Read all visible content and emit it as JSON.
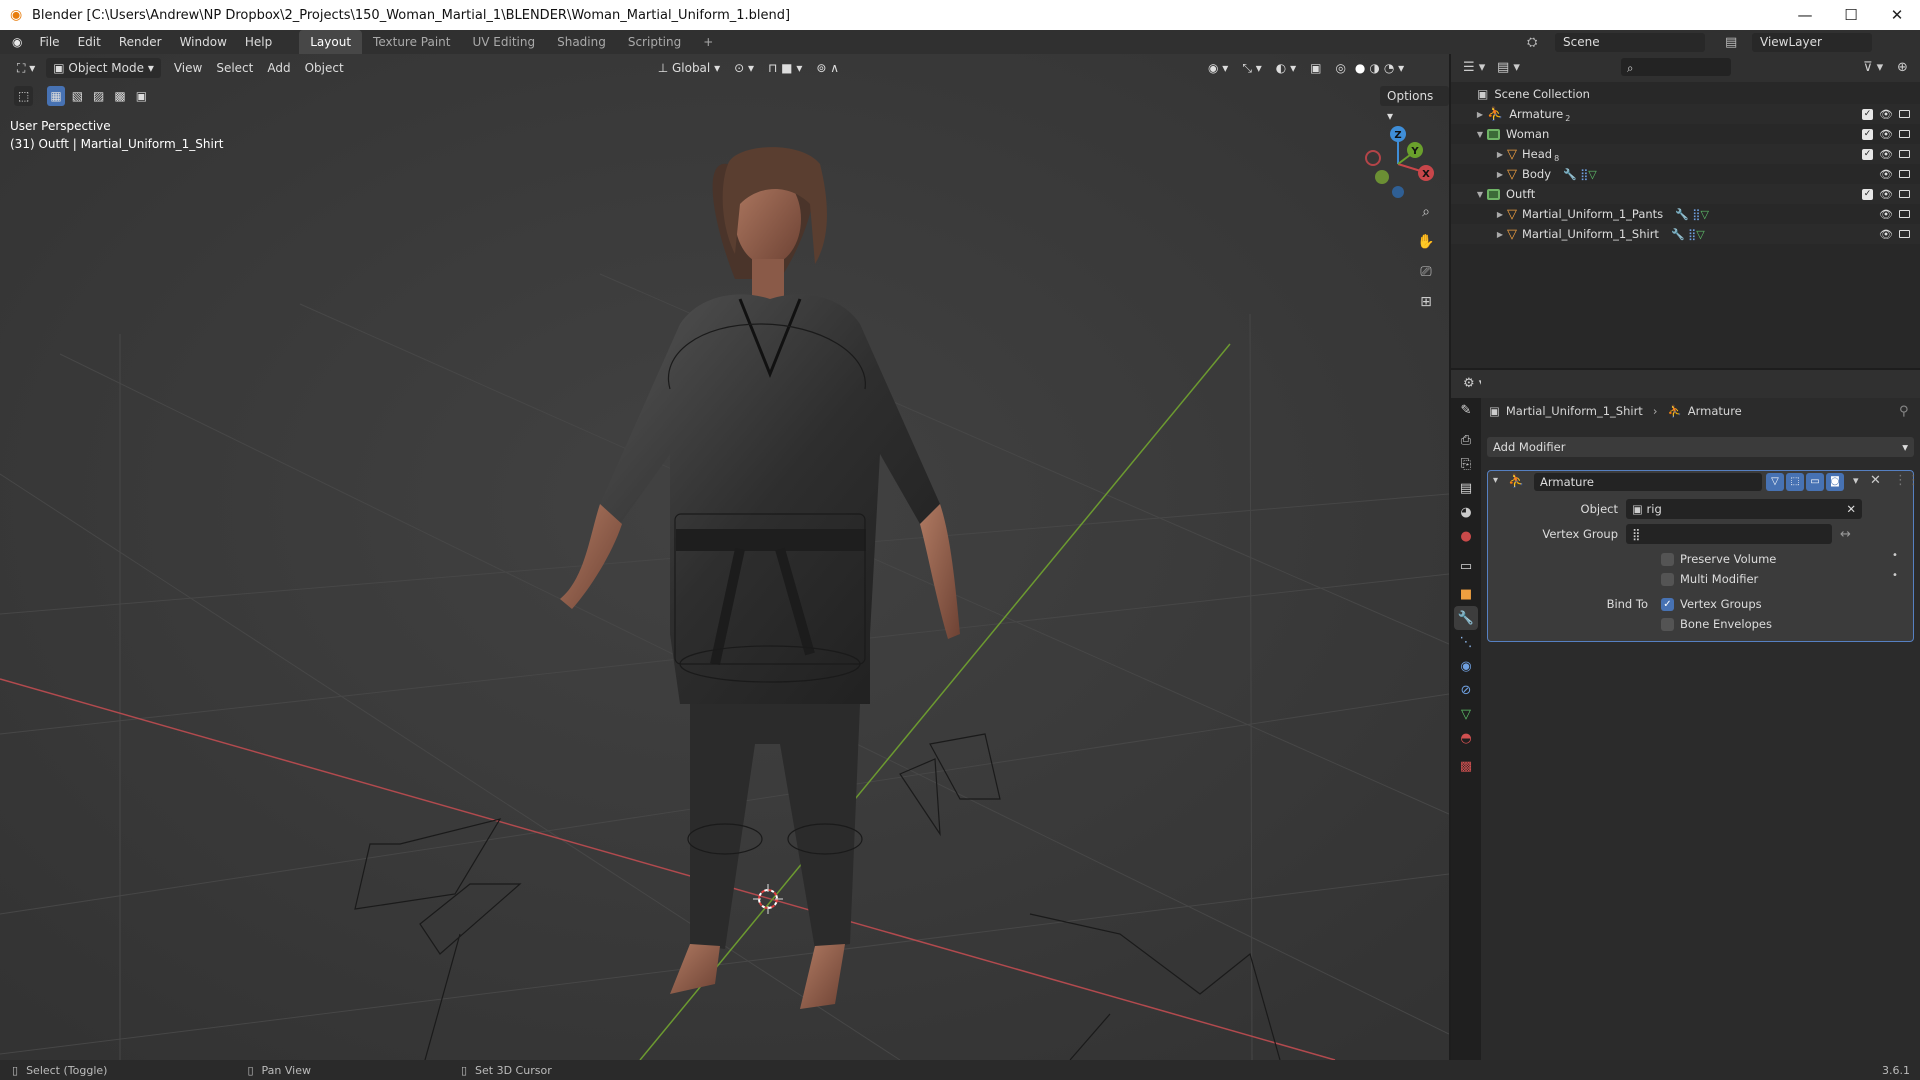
{
  "window": {
    "title": "Blender [C:\\Users\\Andrew\\NP Dropbox\\2_Projects\\150_Woman_Martial_1\\BLENDER\\Woman_Martial_Uniform_1.blend]",
    "minimize": "—",
    "maximize": "☐",
    "close": "✕"
  },
  "menu": [
    "File",
    "Edit",
    "Render",
    "Window",
    "Help"
  ],
  "workspaces": [
    "Layout",
    "Texture Paint",
    "UV Editing",
    "Shading",
    "Scripting",
    "+"
  ],
  "scene": {
    "name": "Scene",
    "view_layer": "ViewLayer"
  },
  "viewport": {
    "mode": "Object Mode",
    "menus": [
      "View",
      "Select",
      "Add",
      "Object"
    ],
    "transform_orientation": "Global",
    "options_label": "Options",
    "perspective_label": "User Perspective",
    "object_info": "(31) Outft | Martial_Uniform_1_Shirt",
    "gizmo_axes": {
      "x": "X",
      "y": "Y",
      "z": "Z"
    }
  },
  "outliner": {
    "root": "Scene Collection",
    "rows": [
      {
        "label": "Armature",
        "type": "armature",
        "level": 1,
        "expanded": false,
        "badge": "2"
      },
      {
        "label": "Woman",
        "type": "collection",
        "level": 1,
        "expanded": true
      },
      {
        "label": "Head",
        "type": "mesh",
        "level": 2,
        "expanded": false,
        "badge": "8"
      },
      {
        "label": "Body",
        "type": "mesh",
        "level": 2,
        "expanded": false
      },
      {
        "label": "Outft",
        "type": "collection",
        "level": 1,
        "expanded": true
      },
      {
        "label": "Martial_Uniform_1_Pants",
        "type": "mesh",
        "level": 2,
        "expanded": false
      },
      {
        "label": "Martial_Uniform_1_Shirt",
        "type": "mesh",
        "level": 2,
        "expanded": false
      }
    ]
  },
  "properties": {
    "breadcrumb_object": "Martial_Uniform_1_Shirt",
    "breadcrumb_modifier": "Armature",
    "add_modifier_label": "Add Modifier",
    "modifier": {
      "name": "Armature",
      "object_label": "Object",
      "object_value": "rig",
      "vertex_group_label": "Vertex Group",
      "vertex_group_value": "",
      "preserve_volume_label": "Preserve Volume",
      "preserve_volume": false,
      "multi_modifier_label": "Multi Modifier",
      "multi_modifier": false,
      "bind_to_label": "Bind To",
      "vertex_groups_label": "Vertex Groups",
      "vertex_groups": true,
      "bone_envelopes_label": "Bone Envelopes",
      "bone_envelopes": false
    }
  },
  "statusbar": {
    "select_label": "Select (Toggle)",
    "pan_label": "Pan View",
    "cursor_label": "Set 3D Cursor",
    "version": "3.6.1"
  },
  "colors": {
    "accent": "#4772b3",
    "x_axis": "#c8464a",
    "y_axis": "#6aa02c",
    "z_axis": "#3f8ed8"
  }
}
